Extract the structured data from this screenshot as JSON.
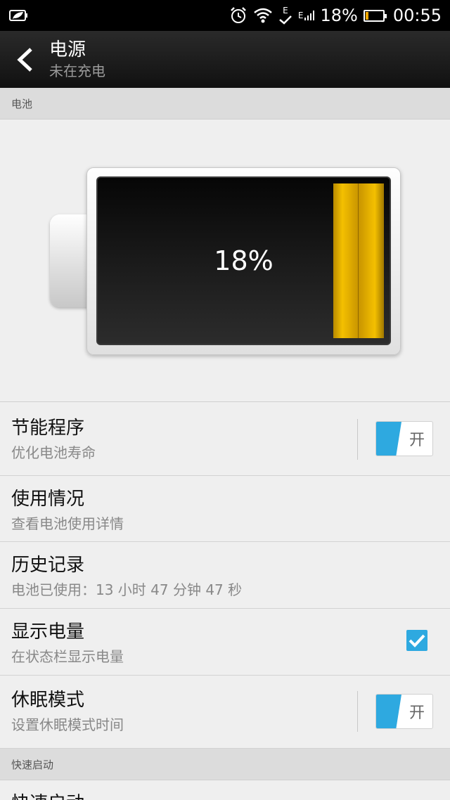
{
  "status_bar": {
    "left_icon": "power-saver-leaf-icon",
    "network_letter_top": "E",
    "network_letter_small": "E",
    "battery_percent": "18%",
    "time": "00:55",
    "battery_level": 0.18,
    "battery_fill_color": "#f0a800"
  },
  "header": {
    "title": "电源",
    "subtitle": "未在充电"
  },
  "sections": {
    "battery": "电池",
    "fast_boot": "快速启动"
  },
  "battery_graphic": {
    "percent_text": "18%",
    "level": 0.18,
    "level_color": "#f4c000"
  },
  "items": {
    "power_saver": {
      "title": "节能程序",
      "subtitle": "优化电池寿命",
      "toggle_label": "开",
      "on": true
    },
    "usage": {
      "title": "使用情况",
      "subtitle": "查看电池使用详情"
    },
    "history": {
      "title": "历史记录",
      "subtitle": "电池已使用：13 小时 47 分钟 47 秒"
    },
    "show_level": {
      "title": "显示电量",
      "subtitle": "在状态栏显示电量",
      "checked": true
    },
    "sleep_mode": {
      "title": "休眠模式",
      "subtitle": "设置休眠模式时间",
      "toggle_label": "开",
      "on": true
    },
    "fast_boot": {
      "title": "快速启动"
    }
  },
  "colors": {
    "accent": "#2ea9e0",
    "battery_gold": "#f4c000"
  }
}
